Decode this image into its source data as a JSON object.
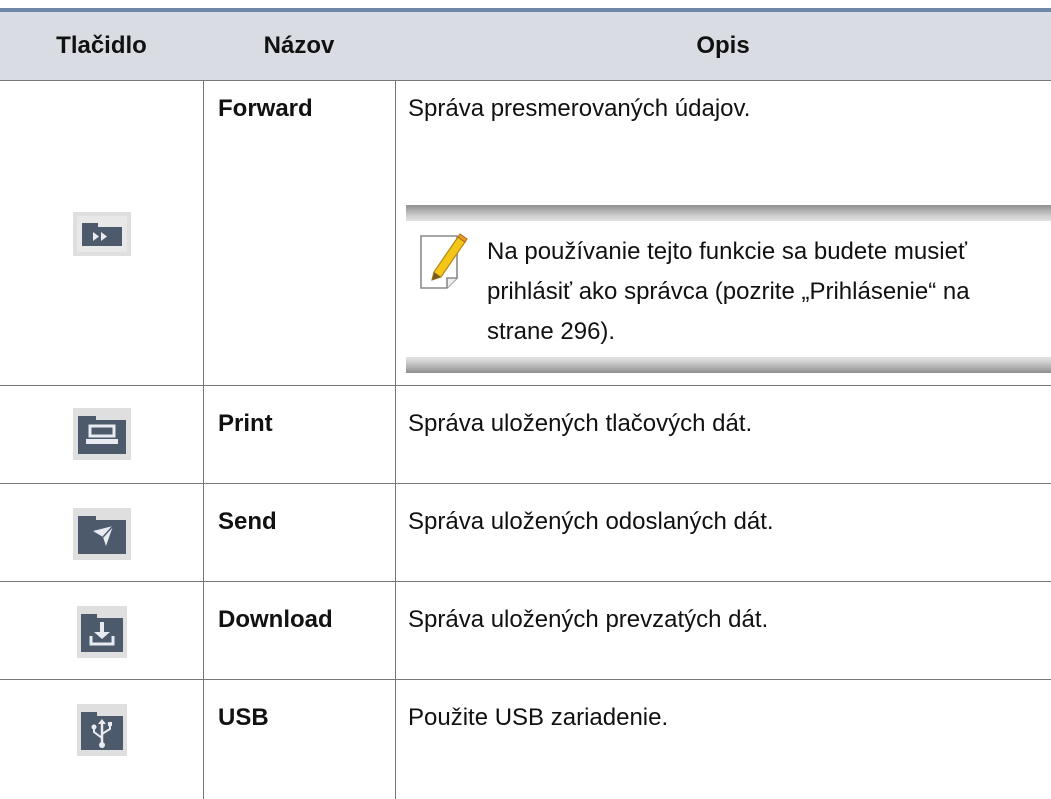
{
  "table": {
    "headers": {
      "button": "Tlačidlo",
      "name": "Názov",
      "description": "Opis"
    },
    "rows": [
      {
        "icon": "forward-icon",
        "name": "Forward",
        "description": "Správa presmerovaných údajov.",
        "note": "Na používanie tejto funkcie sa budete musieť prihlásiť ako správca (pozrite „Prihlásenie“ na strane 296).",
        "note_icon": "note-pencil-icon"
      },
      {
        "icon": "print-icon",
        "name": "Print",
        "description": "Správa uložených tlačových dát."
      },
      {
        "icon": "send-icon",
        "name": "Send",
        "description": "Správa uložených odoslaných dát."
      },
      {
        "icon": "download-icon",
        "name": "Download",
        "description": "Správa uložených prevzatých dát."
      },
      {
        "icon": "usb-icon",
        "name": "USB",
        "description": "Použite USB zariadenie."
      }
    ]
  },
  "colors": {
    "header_background": "#d9dde3",
    "top_rule": "#6f87a6",
    "grid_lines": "#777777"
  }
}
